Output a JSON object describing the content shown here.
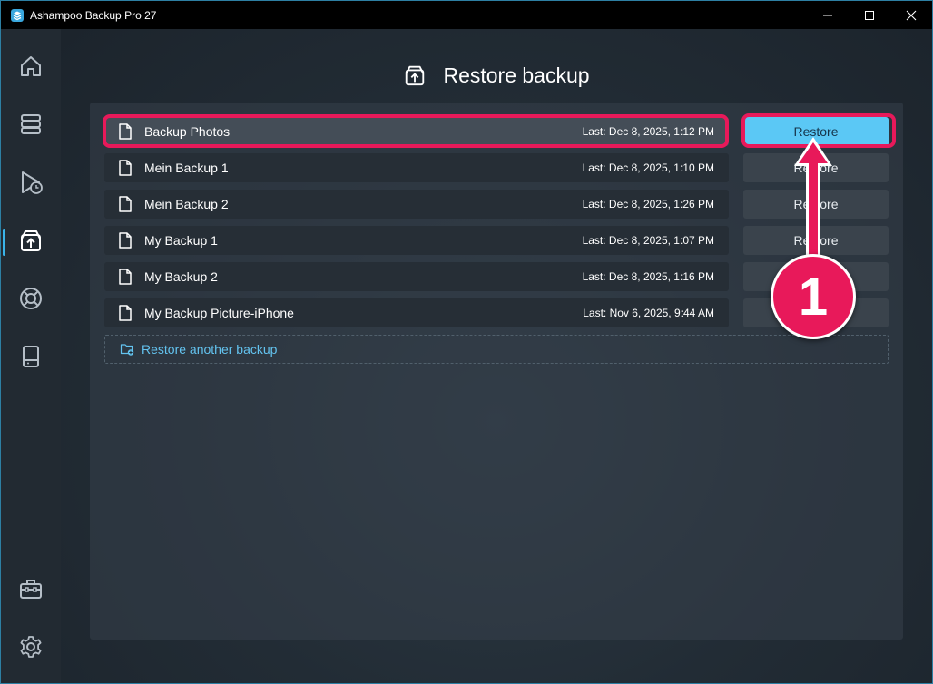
{
  "window": {
    "title": "Ashampoo Backup Pro 27"
  },
  "sidebar": {
    "items": [
      {
        "icon": "home-icon",
        "active": false
      },
      {
        "icon": "backup-plans-icon",
        "active": false
      },
      {
        "icon": "scheduled-backup-icon",
        "active": false
      },
      {
        "icon": "restore-box-icon",
        "active": true
      },
      {
        "icon": "lifebuoy-icon",
        "active": false
      },
      {
        "icon": "drive-icon",
        "active": false
      },
      {
        "icon": "toolbox-icon",
        "active": false
      },
      {
        "icon": "gear-icon",
        "active": false
      }
    ]
  },
  "header": {
    "title": "Restore backup",
    "icon": "restore-box-icon"
  },
  "backups": [
    {
      "name": "Backup Photos",
      "date": "Last: Dec 8, 2025, 1:12 PM",
      "selected": true
    },
    {
      "name": "Mein Backup 1",
      "date": "Last: Dec 8, 2025, 1:10 PM",
      "selected": false
    },
    {
      "name": "Mein Backup 2",
      "date": "Last: Dec 8, 2025, 1:26 PM",
      "selected": false
    },
    {
      "name": "My Backup 1",
      "date": "Last: Dec 8, 2025, 1:07 PM",
      "selected": false
    },
    {
      "name": "My Backup 2",
      "date": "Last: Dec 8, 2025, 1:16 PM",
      "selected": false
    },
    {
      "name": "My Backup Picture-iPhone",
      "date": "Last: Nov 6, 2025, 9:44 AM",
      "selected": false
    }
  ],
  "restore_label": "Restore",
  "restore_another": {
    "label": "Restore another backup",
    "icon": "folder-add-icon"
  },
  "annotation": {
    "step_number": "1",
    "color": "#e8195a"
  },
  "colors": {
    "accent": "#5bc8f5",
    "link": "#63c3ef",
    "highlight": "#e8195a"
  }
}
